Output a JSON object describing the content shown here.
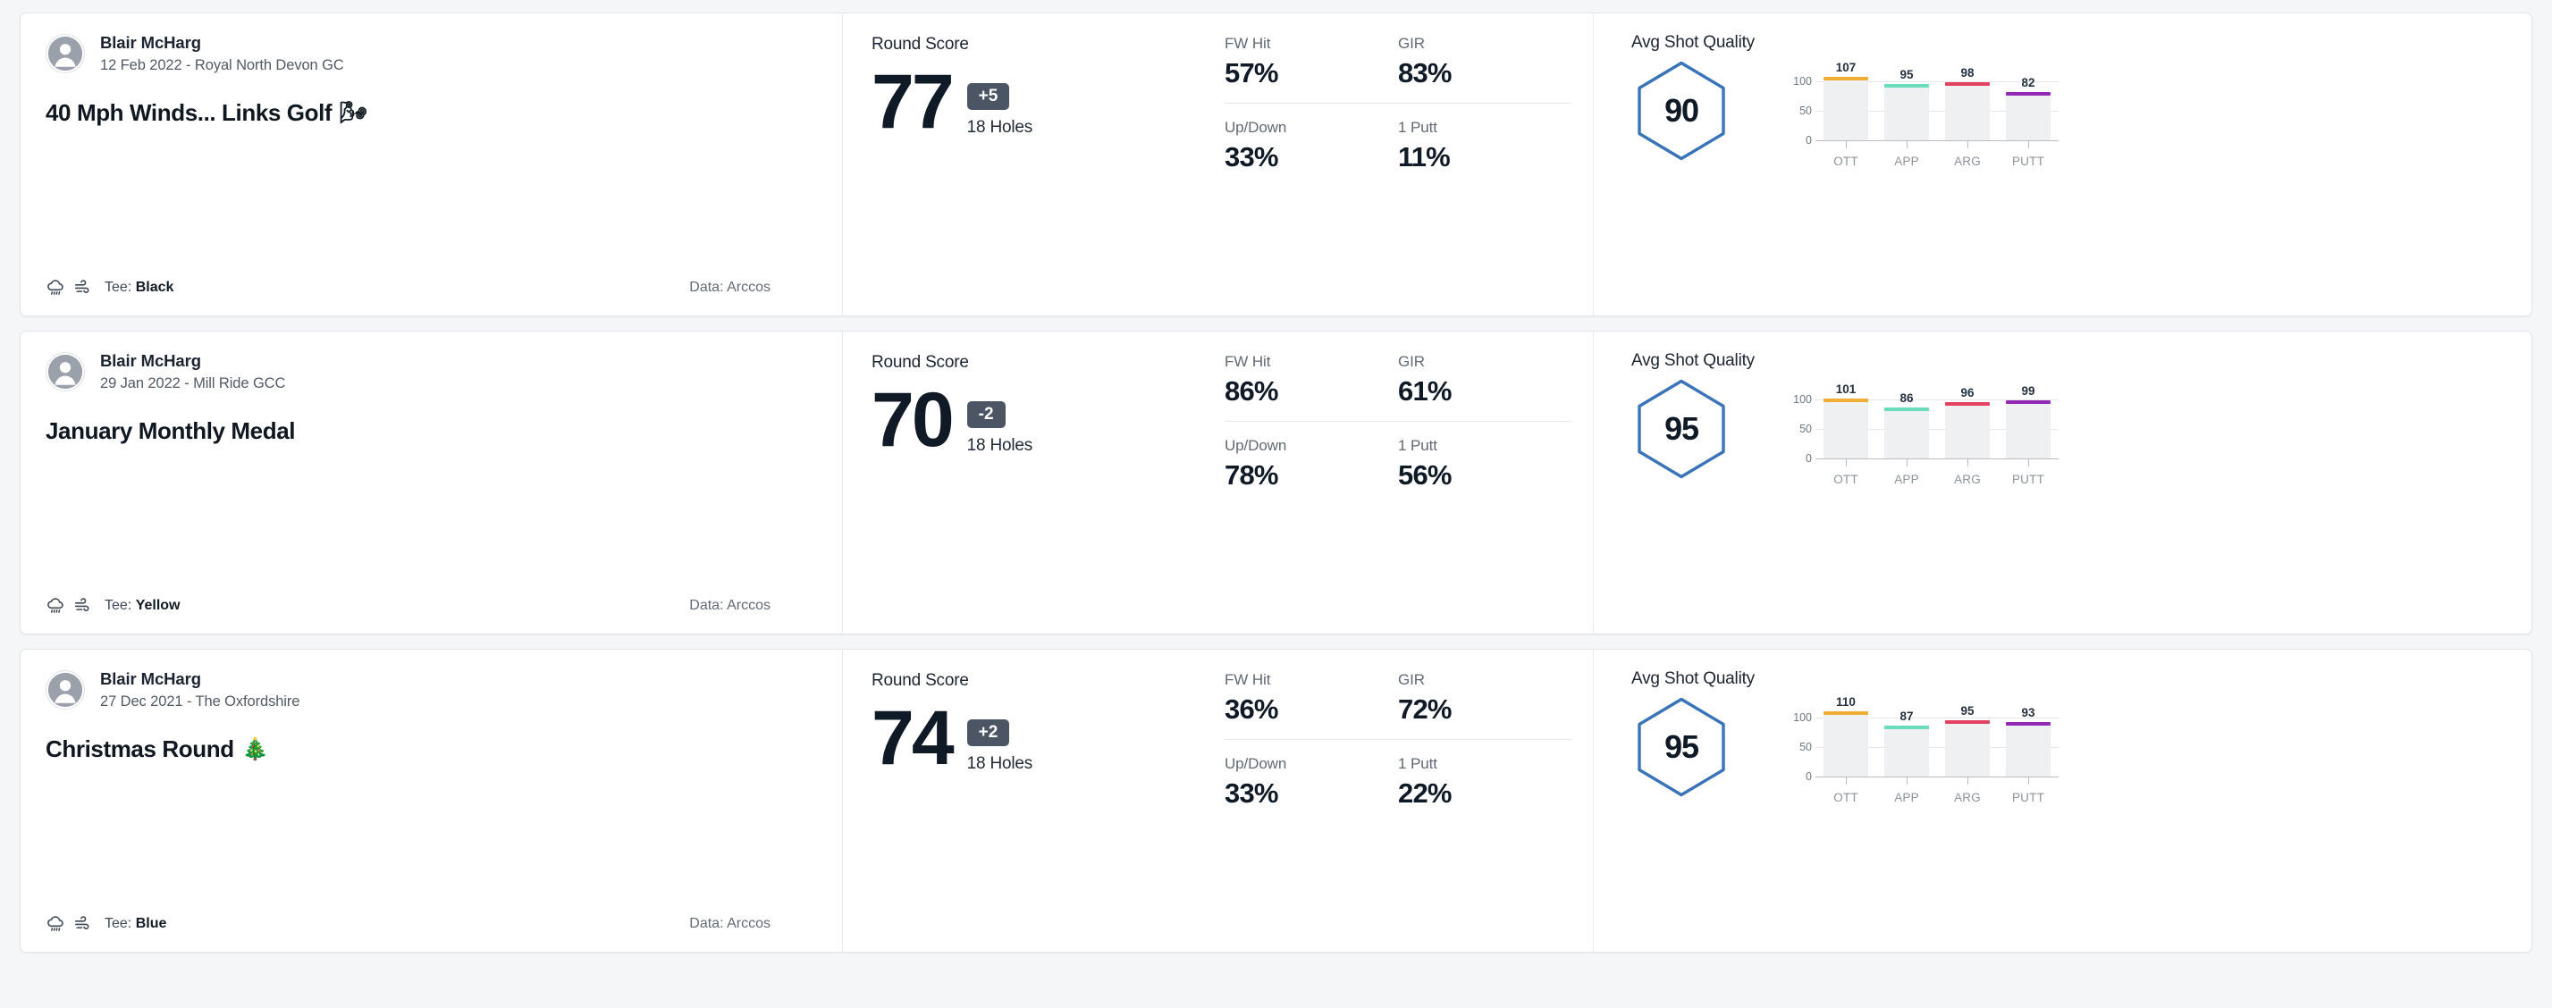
{
  "labels": {
    "round_score": "Round Score",
    "holes": "18 Holes",
    "fw_hit": "FW Hit",
    "gir": "GIR",
    "up_down": "Up/Down",
    "one_putt": "1 Putt",
    "avg_shot_quality": "Avg Shot Quality",
    "tee_prefix": "Tee:",
    "data_prefix": "Data:"
  },
  "colors": {
    "hexagon_stroke": "#3973b8",
    "to_par_badge": "#4b5563",
    "bar_track": "#eff0f1",
    "ott": "#edae33",
    "app": "#68dcbb",
    "arg": "#e2415f",
    "putt": "#9327b7",
    "card_background": "#ffffff",
    "page_background": "#f5f6f8"
  },
  "chart_axis": {
    "yticks": [
      100,
      50,
      0
    ],
    "ymax": 125,
    "categories": [
      "OTT",
      "APP",
      "ARG",
      "PUTT"
    ]
  },
  "rounds": [
    {
      "player": "Blair McHarg",
      "meta": "12 Feb 2022 - Royal North Devon GC",
      "title": "40 Mph Winds... Links Golf",
      "title_emoji": "🌬",
      "weather_icons": [
        "rain-cloud-icon",
        "wind-icon"
      ],
      "tee": "Black",
      "data_source": "Arccos",
      "score": "77",
      "to_par": "+5",
      "holes": "18 Holes",
      "stats": {
        "fw_hit": "57%",
        "gir": "83%",
        "up_down": "33%",
        "one_putt": "11%"
      },
      "shot_quality": "90",
      "chart_data": {
        "type": "bar",
        "title": "Avg Shot Quality",
        "categories": [
          "OTT",
          "APP",
          "ARG",
          "PUTT"
        ],
        "values": [
          107,
          95,
          98,
          82
        ],
        "colors": [
          "#edae33",
          "#68dcbb",
          "#e2415f",
          "#9327b7"
        ],
        "ylim": [
          0,
          125
        ],
        "yticks": [
          0,
          50,
          100
        ],
        "xlabel": "",
        "ylabel": "",
        "grid": true,
        "legend": "none"
      }
    },
    {
      "player": "Blair McHarg",
      "meta": "29 Jan 2022 - Mill Ride GCC",
      "title": "January Monthly Medal",
      "title_emoji": "",
      "weather_icons": [
        "rain-cloud-icon",
        "wind-icon"
      ],
      "tee": "Yellow",
      "data_source": "Arccos",
      "score": "70",
      "to_par": "-2",
      "holes": "18 Holes",
      "stats": {
        "fw_hit": "86%",
        "gir": "61%",
        "up_down": "78%",
        "one_putt": "56%"
      },
      "shot_quality": "95",
      "chart_data": {
        "type": "bar",
        "title": "Avg Shot Quality",
        "categories": [
          "OTT",
          "APP",
          "ARG",
          "PUTT"
        ],
        "values": [
          101,
          86,
          96,
          99
        ],
        "colors": [
          "#edae33",
          "#68dcbb",
          "#e2415f",
          "#9327b7"
        ],
        "ylim": [
          0,
          125
        ],
        "yticks": [
          0,
          50,
          100
        ],
        "xlabel": "",
        "ylabel": "",
        "grid": true,
        "legend": "none"
      }
    },
    {
      "player": "Blair McHarg",
      "meta": "27 Dec 2021 - The Oxfordshire",
      "title": "Christmas Round",
      "title_emoji": "🎄",
      "weather_icons": [
        "rain-cloud-icon",
        "wind-icon"
      ],
      "tee": "Blue",
      "data_source": "Arccos",
      "score": "74",
      "to_par": "+2",
      "holes": "18 Holes",
      "stats": {
        "fw_hit": "36%",
        "gir": "72%",
        "up_down": "33%",
        "one_putt": "22%"
      },
      "shot_quality": "95",
      "chart_data": {
        "type": "bar",
        "title": "Avg Shot Quality",
        "categories": [
          "OTT",
          "APP",
          "ARG",
          "PUTT"
        ],
        "values": [
          110,
          87,
          95,
          93
        ],
        "colors": [
          "#edae33",
          "#68dcbb",
          "#e2415f",
          "#9327b7"
        ],
        "ylim": [
          0,
          125
        ],
        "yticks": [
          0,
          50,
          100
        ],
        "xlabel": "",
        "ylabel": "",
        "grid": true,
        "legend": "none"
      }
    }
  ]
}
